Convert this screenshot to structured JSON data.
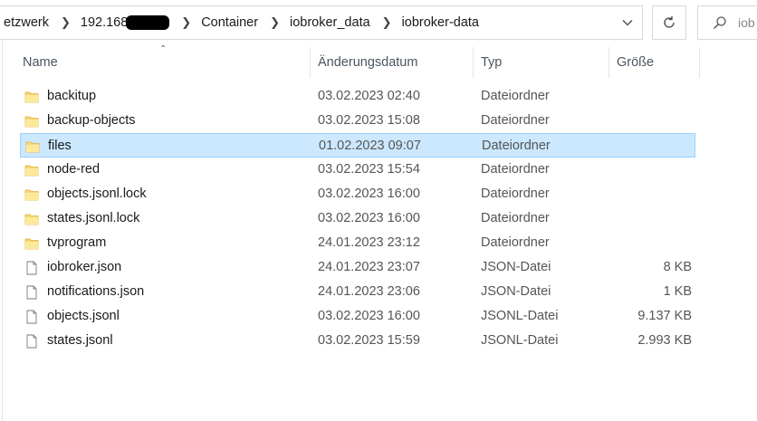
{
  "address": {
    "crumbs": [
      "etzwerk",
      "192.168",
      "Container",
      "iobroker_data",
      "iobroker-data"
    ]
  },
  "search": {
    "placeholder": "iob"
  },
  "columns": [
    "Name",
    "Änderungsdatum",
    "Typ",
    "Größe"
  ],
  "files": [
    {
      "name": "backitup",
      "date": "03.02.2023 02:40",
      "type": "Dateiordner",
      "size": "",
      "kind": "folder-icon"
    },
    {
      "name": "backup-objects",
      "date": "03.02.2023 15:08",
      "type": "Dateiordner",
      "size": "",
      "kind": "folder-icon"
    },
    {
      "name": "files",
      "date": "01.02.2023 09:07",
      "type": "Dateiordner",
      "size": "",
      "kind": "folder-icon"
    },
    {
      "name": "node-red",
      "date": "03.02.2023 15:54",
      "type": "Dateiordner",
      "size": "",
      "kind": "folder-icon"
    },
    {
      "name": "objects.jsonl.lock",
      "date": "03.02.2023 16:00",
      "type": "Dateiordner",
      "size": "",
      "kind": "folder-icon"
    },
    {
      "name": "states.jsonl.lock",
      "date": "03.02.2023 16:00",
      "type": "Dateiordner",
      "size": "",
      "kind": "folder-icon"
    },
    {
      "name": "tvprogram",
      "date": "24.01.2023 23:12",
      "type": "Dateiordner",
      "size": "",
      "kind": "folder-icon"
    },
    {
      "name": "iobroker.json",
      "date": "24.01.2023 23:07",
      "type": "JSON-Datei",
      "size": "8 KB",
      "kind": "file-icon"
    },
    {
      "name": "notifications.json",
      "date": "24.01.2023 23:06",
      "type": "JSON-Datei",
      "size": "1 KB",
      "kind": "file-icon"
    },
    {
      "name": "objects.jsonl",
      "date": "03.02.2023 16:00",
      "type": "JSONL-Datei",
      "size": "9.137 KB",
      "kind": "file-icon"
    },
    {
      "name": "states.jsonl",
      "date": "03.02.2023 15:59",
      "type": "JSONL-Datei",
      "size": "2.993 KB",
      "kind": "file-icon"
    }
  ],
  "selected_index": 2,
  "colors": {
    "selection_bg": "#cce8ff",
    "selection_border": "#99d1ff",
    "folder": "#f8d775"
  }
}
